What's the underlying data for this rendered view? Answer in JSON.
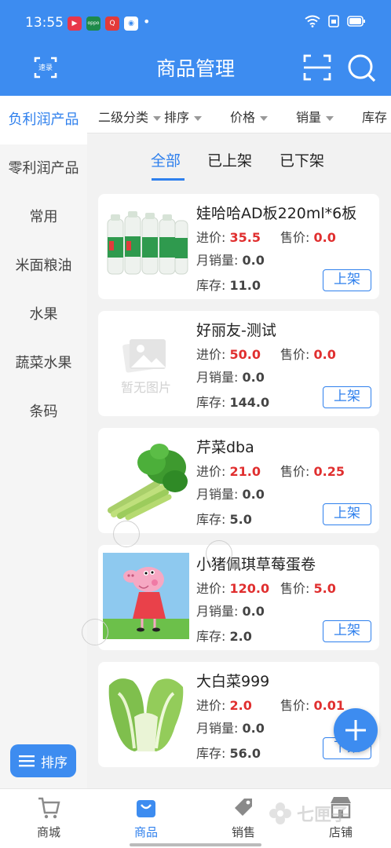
{
  "status_bar": {
    "time": "13:55",
    "dot": "•"
  },
  "header": {
    "title": "商品管理",
    "quick_record_label": "速录"
  },
  "sidebar": {
    "items": [
      {
        "label": "负利润产品",
        "active": true
      },
      {
        "label": "零利润产品"
      },
      {
        "label": "常用"
      },
      {
        "label": "米面粮油"
      },
      {
        "label": "水果"
      },
      {
        "label": "蔬菜水果"
      },
      {
        "label": "条码"
      }
    ],
    "sort_button": "排序"
  },
  "filters": [
    "二级分类",
    "排序",
    "价格",
    "销量",
    "库存"
  ],
  "tabs": [
    {
      "label": "全部",
      "active": true
    },
    {
      "label": "已上架"
    },
    {
      "label": "已下架"
    }
  ],
  "products": [
    {
      "name": "娃哈哈AD板220ml*6板",
      "cost_label": "进价:",
      "cost": "35.5",
      "sale_label": "售价:",
      "sale": "0.0",
      "monthly_label": "月销量:",
      "monthly": "0.0",
      "stock_label": "库存:",
      "stock": "11.0",
      "action": "上架"
    },
    {
      "name": "好丽友-测试",
      "cost_label": "进价:",
      "cost": "50.0",
      "sale_label": "售价:",
      "sale": "0.0",
      "monthly_label": "月销量:",
      "monthly": "0.0",
      "stock_label": "库存:",
      "stock": "144.0",
      "action": "上架",
      "no_image_text": "暂无图片"
    },
    {
      "name": "芹菜dba",
      "cost_label": "进价:",
      "cost": "21.0",
      "sale_label": "售价:",
      "sale": "0.25",
      "monthly_label": "月销量:",
      "monthly": "0.0",
      "stock_label": "库存:",
      "stock": "5.0",
      "action": "上架"
    },
    {
      "name": "小猪佩琪草莓蛋卷",
      "cost_label": "进价:",
      "cost": "120.0",
      "sale_label": "售价:",
      "sale": "5.0",
      "monthly_label": "月销量:",
      "monthly": "0.0",
      "stock_label": "库存:",
      "stock": "2.0",
      "action": "上架"
    },
    {
      "name": "大白菜999",
      "cost_label": "进价:",
      "cost": "2.0",
      "sale_label": "售价:",
      "sale": "0.01",
      "monthly_label": "月销量:",
      "monthly": "0.0",
      "stock_label": "库存:",
      "stock": "56.0",
      "action": "下架"
    }
  ],
  "bottom_nav": [
    {
      "label": "商城",
      "icon": "cart-icon"
    },
    {
      "label": "商品",
      "icon": "bag-icon",
      "active": true
    },
    {
      "label": "销售",
      "icon": "tag-icon"
    },
    {
      "label": "店铺",
      "icon": "store-icon"
    }
  ],
  "watermark": "七匣子",
  "colors": {
    "primary": "#3d8cf0",
    "accent_text": "#2f80ed",
    "price_red": "#e02f2f"
  }
}
